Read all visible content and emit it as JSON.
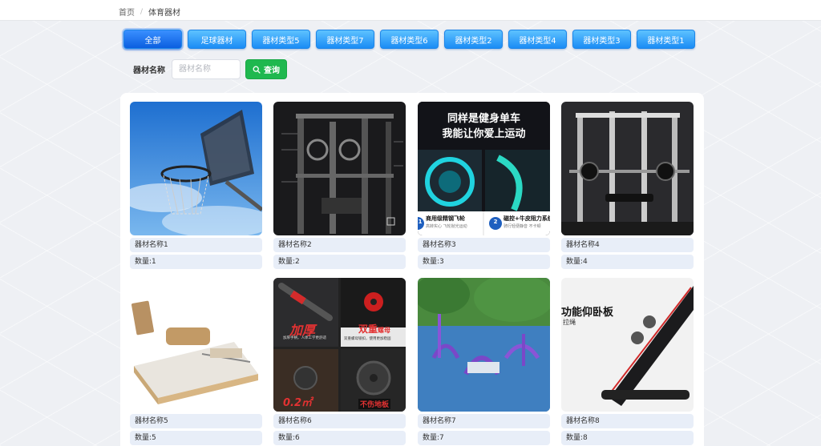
{
  "breadcrumb": {
    "home": "首页",
    "separator": "/",
    "current": "体育器材"
  },
  "tabs": [
    "全部",
    "足球器材",
    "器材类型5",
    "器材类型7",
    "器材类型6",
    "器材类型2",
    "器材类型4",
    "器材类型3",
    "器材类型1"
  ],
  "search": {
    "label": "器材名称",
    "placeholder": "器材名称",
    "button_label": "查询"
  },
  "cards": [
    {
      "name": "器材名称1",
      "qty": "数量:1"
    },
    {
      "name": "器材名称2",
      "qty": "数量:2"
    },
    {
      "name": "器材名称3",
      "qty": "数量:3",
      "overlay": {
        "title1": "同样是健身单车",
        "title2": "我能让你爱上运动",
        "badge1_num": "1",
        "badge1_title": "商用级精钢飞轮",
        "badge1_sub": "高转实心 飞轮抛光运动",
        "badge2_num": "2",
        "badge2_title": "磁控+牛皮阻力系统",
        "badge2_sub": "骑行轻便静音 不卡顿"
      }
    },
    {
      "name": "器材名称4",
      "qty": "数量:4"
    },
    {
      "name": "器材名称5",
      "qty": "数量:5"
    },
    {
      "name": "器材名称6",
      "qty": "数量:6",
      "overlay": {
        "tag1": "加厚",
        "tag1_sub": "加厚手柄，人体工学更舒适",
        "tag2": "双重",
        "tag2_b": "螺母",
        "tag2_sub": "双重螺母锁扣，使用更加稳固",
        "tag3": "0.2㎡",
        "tag4": "不伤地板"
      }
    },
    {
      "name": "器材名称7",
      "qty": "数量:7"
    },
    {
      "name": "器材名称8",
      "qty": "数量:8",
      "overlay": {
        "title": "功能仰卧板",
        "sub": "拉绳"
      }
    }
  ],
  "colors": {
    "tab": "#1a8cf5",
    "tab_active": "#0b5fe0",
    "search_button": "#1fb84f",
    "field_bg": "#e8eef8"
  }
}
